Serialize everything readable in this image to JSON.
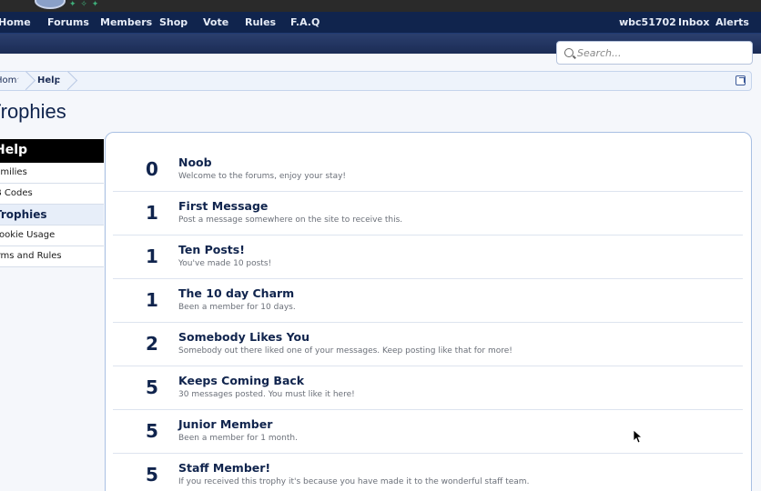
{
  "nav": {
    "items": [
      "Home",
      "Forums",
      "Members",
      "Shop",
      "Vote",
      "Rules",
      "F.A.Q"
    ],
    "user": "wbc51702",
    "inbox": "Inbox",
    "alerts": "Alerts"
  },
  "search": {
    "placeholder": "Search..."
  },
  "breadcrumb": [
    "Home",
    "Help"
  ],
  "page": {
    "title": "Trophies"
  },
  "sidebar": {
    "heading": "Help",
    "items": [
      {
        "label": "Smilies",
        "active": false
      },
      {
        "label": "BB Codes",
        "active": false
      },
      {
        "label": "Trophies",
        "active": true
      },
      {
        "label": "Cookie Usage",
        "active": false
      },
      {
        "label": "Terms and Rules",
        "active": false
      }
    ]
  },
  "trophies": [
    {
      "points": "0",
      "title": "Noob",
      "description": "Welcome to the forums, enjoy your stay!"
    },
    {
      "points": "1",
      "title": "First Message",
      "description": "Post a message somewhere on the site to receive this."
    },
    {
      "points": "1",
      "title": "Ten Posts!",
      "description": "You've made 10 posts!"
    },
    {
      "points": "1",
      "title": "The 10 day Charm",
      "description": "Been a member for 10 days."
    },
    {
      "points": "2",
      "title": "Somebody Likes You",
      "description": "Somebody out there liked one of your messages. Keep posting like that for more!"
    },
    {
      "points": "5",
      "title": "Keeps Coming Back",
      "description": "30 messages posted. You must like it here!"
    },
    {
      "points": "5",
      "title": "Junior Member",
      "description": "Been a member for 1 month."
    },
    {
      "points": "5",
      "title": "Staff Member!",
      "description": "If you received this trophy it's because you have made it to the wonderful staff team."
    }
  ]
}
